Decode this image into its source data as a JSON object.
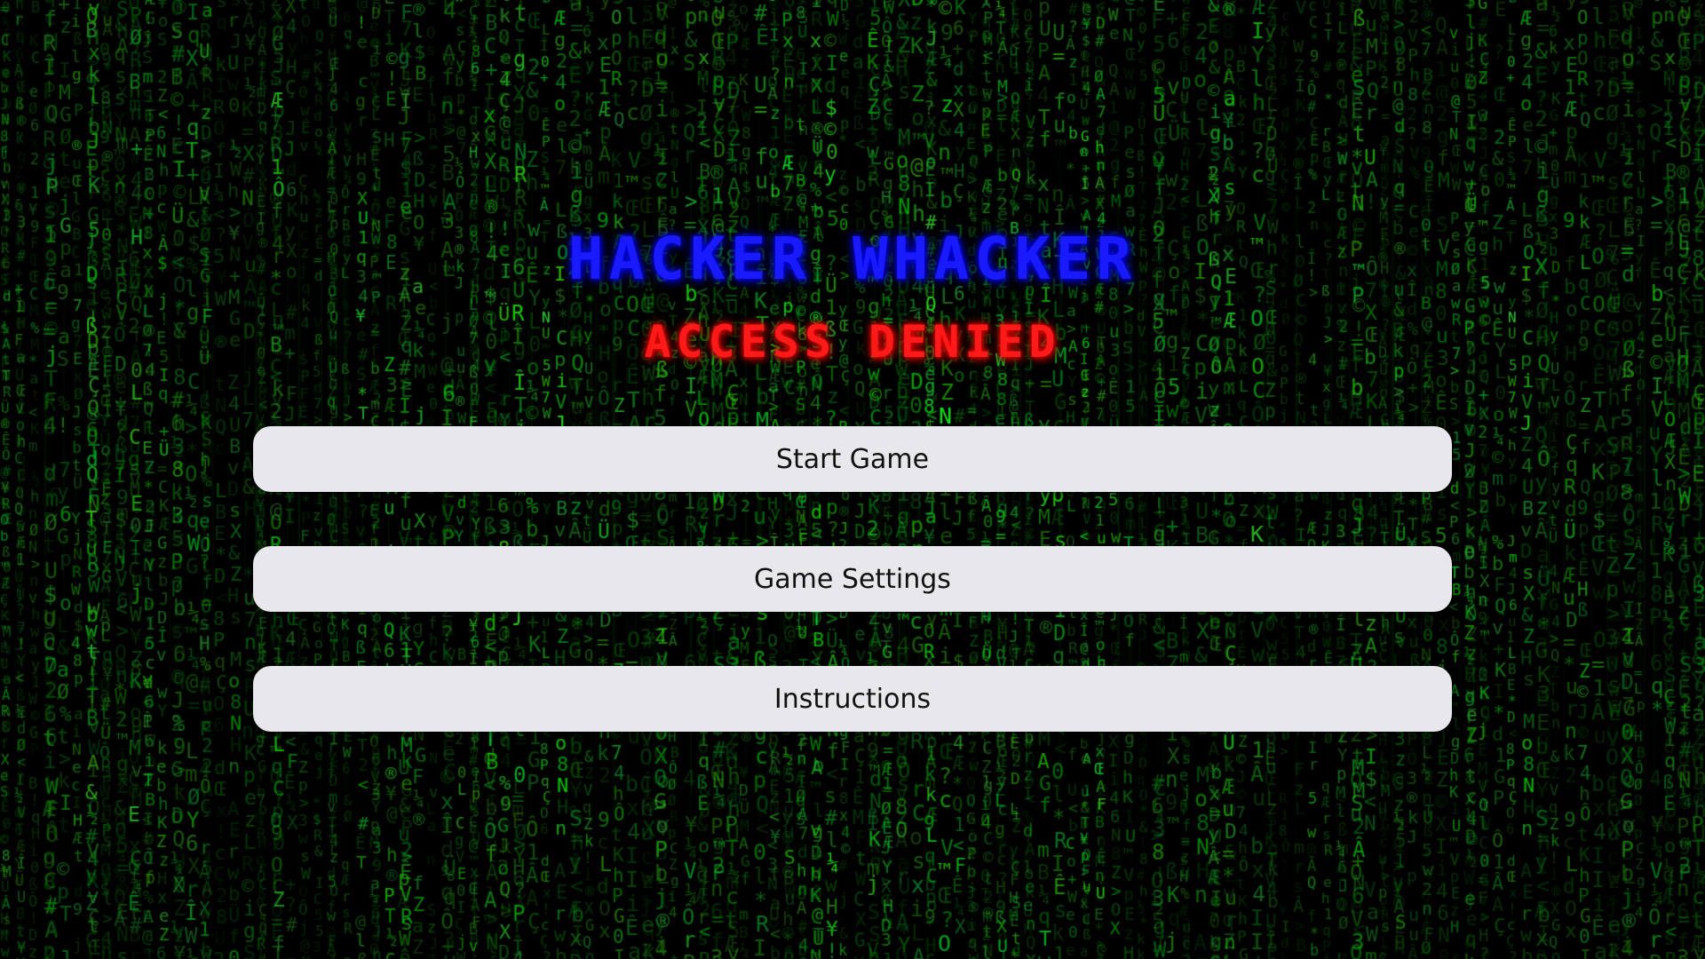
{
  "game": {
    "title": "HACKER WHACKER",
    "subtitle": "ACCESS DENIED"
  },
  "menu": {
    "start_label": "Start Game",
    "settings_label": "Game Settings",
    "instructions_label": "Instructions"
  },
  "colors": {
    "background": "#000000",
    "matrix_green": "#1aff3a",
    "title_blue": "#1a1aff",
    "subtitle_red": "#ff1a1a",
    "button_bg": "#e8e7ec",
    "button_text": "#111111"
  }
}
